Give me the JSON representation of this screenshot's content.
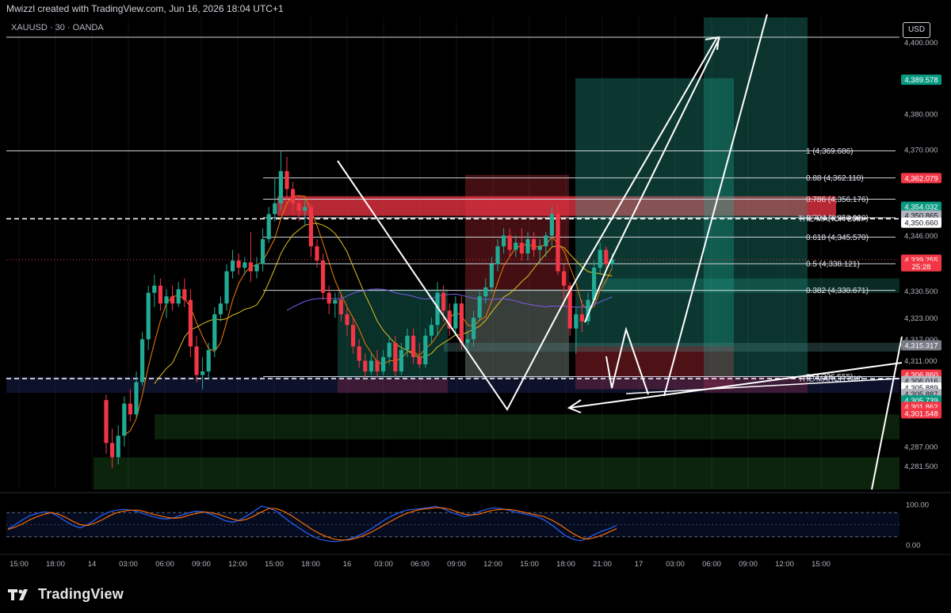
{
  "header": {
    "text": "Mwizzl created with TradingView.com, Jun 16, 2026 18:04 UTC+1",
    "symbol": "XAUUSD · 30 · OANDA",
    "currency": "USD"
  },
  "footer": {
    "brand": "TradingView"
  },
  "colors": {
    "up": "#22ab94",
    "down": "#f23645",
    "fast_ma": "#f57c00",
    "slow_ma": "#e0c020",
    "long_ma": "#7b5ce8",
    "stoch_k": "#2962ff",
    "stoch_d": "#ff6d00"
  },
  "chart_data": {
    "type": "candlestick",
    "symbol": "XAUUSD",
    "timeframe": "30",
    "ylim": [
      4275,
      4407
    ],
    "y_ticks": [
      4400,
      4390,
      4380,
      4370,
      4362,
      4350,
      4346,
      4338,
      4330.5,
      4323,
      4317,
      4311,
      4299,
      4287,
      4281.5
    ],
    "y_tick_labels": [
      "4,400.000",
      "",
      "4,380.000",
      "4,370.000",
      "",
      "",
      "4,346.000",
      "",
      "4,330.500",
      "4,323.000",
      "4,317.000",
      "4,311.000",
      "",
      "4,287.000",
      "4,281.500"
    ],
    "x_ticks": [
      "15:00",
      "18:00",
      "14",
      "03:00",
      "06:00",
      "09:00",
      "12:00",
      "15:00",
      "18:00",
      "16",
      "03:00",
      "06:00",
      "09:00",
      "12:00",
      "15:00",
      "18:00",
      "21:00",
      "17",
      "03:00",
      "06:00",
      "09:00",
      "12:00",
      "15:00"
    ],
    "candles": [
      {
        "i": 0,
        "o": 4300.0,
        "h": 4301.5,
        "l": 4285.0,
        "c": 4288.0
      },
      {
        "i": 1,
        "o": 4288.0,
        "h": 4292.0,
        "l": 4281.0,
        "c": 4284.0
      },
      {
        "i": 2,
        "o": 4284.0,
        "h": 4293.0,
        "l": 4282.0,
        "c": 4290.0
      },
      {
        "i": 3,
        "o": 4290.0,
        "h": 4301.0,
        "l": 4287.0,
        "c": 4299.0
      },
      {
        "i": 4,
        "o": 4299.0,
        "h": 4303.0,
        "l": 4294.0,
        "c": 4296.0
      },
      {
        "i": 5,
        "o": 4296.0,
        "h": 4308.0,
        "l": 4295.0,
        "c": 4305.0
      },
      {
        "i": 6,
        "o": 4305.0,
        "h": 4319.0,
        "l": 4304.0,
        "c": 4317.0
      },
      {
        "i": 7,
        "o": 4317.0,
        "h": 4332.0,
        "l": 4314.0,
        "c": 4330.0
      },
      {
        "i": 8,
        "o": 4330.0,
        "h": 4335.0,
        "l": 4326.0,
        "c": 4332.0
      },
      {
        "i": 9,
        "o": 4332.0,
        "h": 4334.0,
        "l": 4325.0,
        "c": 4327.0
      },
      {
        "i": 10,
        "o": 4327.0,
        "h": 4331.0,
        "l": 4323.0,
        "c": 4329.0
      },
      {
        "i": 11,
        "o": 4329.0,
        "h": 4332.0,
        "l": 4325.0,
        "c": 4327.0
      },
      {
        "i": 12,
        "o": 4327.0,
        "h": 4333.0,
        "l": 4326.0,
        "c": 4331.0
      },
      {
        "i": 13,
        "o": 4331.0,
        "h": 4334.0,
        "l": 4326.0,
        "c": 4328.0
      },
      {
        "i": 14,
        "o": 4328.0,
        "h": 4331.0,
        "l": 4312.0,
        "c": 4315.0
      },
      {
        "i": 15,
        "o": 4315.0,
        "h": 4318.0,
        "l": 4305.0,
        "c": 4307.0
      },
      {
        "i": 16,
        "o": 4307.0,
        "h": 4312.0,
        "l": 4303.0,
        "c": 4308.0
      },
      {
        "i": 17,
        "o": 4308.0,
        "h": 4316.0,
        "l": 4306.0,
        "c": 4314.0
      },
      {
        "i": 18,
        "o": 4314.0,
        "h": 4326.0,
        "l": 4312.0,
        "c": 4324.0
      },
      {
        "i": 19,
        "o": 4324.0,
        "h": 4329.0,
        "l": 4322.0,
        "c": 4327.0
      },
      {
        "i": 20,
        "o": 4327.0,
        "h": 4338.0,
        "l": 4325.0,
        "c": 4336.0
      },
      {
        "i": 21,
        "o": 4336.0,
        "h": 4342.0,
        "l": 4334.0,
        "c": 4339.0
      },
      {
        "i": 22,
        "o": 4339.0,
        "h": 4341.0,
        "l": 4335.0,
        "c": 4337.0
      },
      {
        "i": 23,
        "o": 4337.0,
        "h": 4340.0,
        "l": 4335.0,
        "c": 4338.5
      },
      {
        "i": 24,
        "o": 4338.5,
        "h": 4347.0,
        "l": 4333.0,
        "c": 4336.0
      },
      {
        "i": 25,
        "o": 4336.0,
        "h": 4340.0,
        "l": 4334.0,
        "c": 4338.0
      },
      {
        "i": 26,
        "o": 4338.0,
        "h": 4348.0,
        "l": 4336.0,
        "c": 4345.0
      },
      {
        "i": 27,
        "o": 4345.0,
        "h": 4354.0,
        "l": 4344.0,
        "c": 4352.0
      },
      {
        "i": 28,
        "o": 4352.0,
        "h": 4362.0,
        "l": 4350.0,
        "c": 4355.0
      },
      {
        "i": 29,
        "o": 4355.0,
        "h": 4369.5,
        "l": 4353.0,
        "c": 4364.0
      },
      {
        "i": 30,
        "o": 4364.0,
        "h": 4368.0,
        "l": 4356.0,
        "c": 4359.0
      },
      {
        "i": 31,
        "o": 4359.0,
        "h": 4361.0,
        "l": 4352.0,
        "c": 4355.0
      },
      {
        "i": 32,
        "o": 4355.0,
        "h": 4357.0,
        "l": 4350.0,
        "c": 4353.0
      },
      {
        "i": 33,
        "o": 4353.0,
        "h": 4356.0,
        "l": 4349.0,
        "c": 4354.0
      },
      {
        "i": 34,
        "o": 4354.0,
        "h": 4355.0,
        "l": 4340.0,
        "c": 4343.0
      },
      {
        "i": 35,
        "o": 4343.0,
        "h": 4345.0,
        "l": 4337.0,
        "c": 4339.0
      },
      {
        "i": 36,
        "o": 4339.0,
        "h": 4341.0,
        "l": 4328.0,
        "c": 4330.0
      },
      {
        "i": 37,
        "o": 4330.0,
        "h": 4332.0,
        "l": 4324.0,
        "c": 4327.0
      },
      {
        "i": 38,
        "o": 4327.0,
        "h": 4330.0,
        "l": 4323.0,
        "c": 4328.0
      },
      {
        "i": 39,
        "o": 4328.0,
        "h": 4330.0,
        "l": 4322.0,
        "c": 4324.0
      },
      {
        "i": 40,
        "o": 4324.0,
        "h": 4326.0,
        "l": 4318.0,
        "c": 4321.0
      },
      {
        "i": 41,
        "o": 4321.0,
        "h": 4323.0,
        "l": 4313.0,
        "c": 4315.0
      },
      {
        "i": 42,
        "o": 4315.0,
        "h": 4317.0,
        "l": 4309.0,
        "c": 4311.0
      },
      {
        "i": 43,
        "o": 4311.0,
        "h": 4313.0,
        "l": 4306.0,
        "c": 4308.0
      },
      {
        "i": 44,
        "o": 4308.0,
        "h": 4313.0,
        "l": 4307.0,
        "c": 4311.0
      },
      {
        "i": 45,
        "o": 4311.0,
        "h": 4314.0,
        "l": 4306.0,
        "c": 4308.0
      },
      {
        "i": 46,
        "o": 4308.0,
        "h": 4314.0,
        "l": 4307.0,
        "c": 4312.0
      },
      {
        "i": 47,
        "o": 4312.0,
        "h": 4318.0,
        "l": 4310.0,
        "c": 4316.0
      },
      {
        "i": 48,
        "o": 4316.0,
        "h": 4318.0,
        "l": 4306.5,
        "c": 4308.0
      },
      {
        "i": 49,
        "o": 4308.0,
        "h": 4316.0,
        "l": 4307.0,
        "c": 4314.0
      },
      {
        "i": 50,
        "o": 4314.0,
        "h": 4320.0,
        "l": 4312.0,
        "c": 4318.0
      },
      {
        "i": 51,
        "o": 4318.0,
        "h": 4320.0,
        "l": 4310.0,
        "c": 4312.0
      },
      {
        "i": 52,
        "o": 4312.0,
        "h": 4316.0,
        "l": 4309.0,
        "c": 4310.0
      },
      {
        "i": 53,
        "o": 4310.0,
        "h": 4320.0,
        "l": 4309.0,
        "c": 4318.0
      },
      {
        "i": 54,
        "o": 4318.0,
        "h": 4323.0,
        "l": 4316.0,
        "c": 4321.0
      },
      {
        "i": 55,
        "o": 4321.0,
        "h": 4333.0,
        "l": 4318.0,
        "c": 4330.0
      },
      {
        "i": 56,
        "o": 4330.0,
        "h": 4332.0,
        "l": 4322.0,
        "c": 4325.0
      },
      {
        "i": 57,
        "o": 4325.0,
        "h": 4327.0,
        "l": 4318.0,
        "c": 4320.0
      },
      {
        "i": 58,
        "o": 4320.0,
        "h": 4329.0,
        "l": 4318.0,
        "c": 4327.0
      },
      {
        "i": 59,
        "o": 4327.0,
        "h": 4329.0,
        "l": 4314.0,
        "c": 4316.0
      },
      {
        "i": 60,
        "o": 4316.0,
        "h": 4319.0,
        "l": 4313.0,
        "c": 4317.0
      },
      {
        "i": 61,
        "o": 4317.0,
        "h": 4325.0,
        "l": 4315.0,
        "c": 4323.0
      },
      {
        "i": 62,
        "o": 4323.0,
        "h": 4331.0,
        "l": 4322.0,
        "c": 4329.0
      },
      {
        "i": 63,
        "o": 4329.0,
        "h": 4334.0,
        "l": 4327.0,
        "c": 4331.5
      },
      {
        "i": 64,
        "o": 4331.5,
        "h": 4340.0,
        "l": 4330.0,
        "c": 4338.0
      },
      {
        "i": 65,
        "o": 4338.0,
        "h": 4345.0,
        "l": 4336.0,
        "c": 4343.0
      },
      {
        "i": 66,
        "o": 4343.0,
        "h": 4348.0,
        "l": 4341.0,
        "c": 4346.0
      },
      {
        "i": 67,
        "o": 4346.0,
        "h": 4348.0,
        "l": 4340.0,
        "c": 4342.0
      },
      {
        "i": 68,
        "o": 4342.0,
        "h": 4346.0,
        "l": 4340.0,
        "c": 4344.0
      },
      {
        "i": 69,
        "o": 4344.0,
        "h": 4348.0,
        "l": 4339.0,
        "c": 4341.0
      },
      {
        "i": 70,
        "o": 4341.0,
        "h": 4347.0,
        "l": 4339.0,
        "c": 4345.0
      },
      {
        "i": 71,
        "o": 4345.0,
        "h": 4347.0,
        "l": 4340.0,
        "c": 4342.0
      },
      {
        "i": 72,
        "o": 4342.0,
        "h": 4345.0,
        "l": 4338.0,
        "c": 4343.0
      },
      {
        "i": 73,
        "o": 4343.0,
        "h": 4347.0,
        "l": 4340.0,
        "c": 4346.0
      },
      {
        "i": 74,
        "o": 4346.0,
        "h": 4354.0,
        "l": 4343.0,
        "c": 4352.0
      },
      {
        "i": 75,
        "o": 4352.0,
        "h": 4354.5,
        "l": 4335.0,
        "c": 4336.0
      },
      {
        "i": 76,
        "o": 4336.0,
        "h": 4338.0,
        "l": 4326.0,
        "c": 4332.0
      },
      {
        "i": 77,
        "o": 4332.0,
        "h": 4333.0,
        "l": 4318.0,
        "c": 4320.0
      },
      {
        "i": 78,
        "o": 4320.0,
        "h": 4326.0,
        "l": 4313.0,
        "c": 4324.0
      },
      {
        "i": 79,
        "o": 4324.0,
        "h": 4328.0,
        "l": 4319.0,
        "c": 4322.0
      },
      {
        "i": 80,
        "o": 4322.0,
        "h": 4330.0,
        "l": 4321.0,
        "c": 4328.0
      },
      {
        "i": 81,
        "o": 4328.0,
        "h": 4339.0,
        "l": 4327.0,
        "c": 4337.0
      },
      {
        "i": 82,
        "o": 4337.0,
        "h": 4344.0,
        "l": 4335.0,
        "c": 4342.0
      },
      {
        "i": 83,
        "o": 4342.0,
        "h": 4343.0,
        "l": 4337.0,
        "c": 4338.0
      },
      {
        "i": 84,
        "o": 4338.0,
        "h": 4341.0,
        "l": 4337.0,
        "c": 4339.3
      }
    ],
    "fib_levels": [
      {
        "ratio": "1",
        "price": 4369.686,
        "label": "1 (4,369.686)"
      },
      {
        "ratio": "0.88",
        "price": 4362.11,
        "label": "0.88 (4,362.110)"
      },
      {
        "ratio": "0.786",
        "price": 4356.176,
        "label": "0.786 (4,356.176)"
      },
      {
        "ratio": "0.704",
        "price": 4351.0,
        "label": "0.704 (4,350.990)"
      },
      {
        "ratio": "0.618",
        "price": 4345.57,
        "label": "0.618 (4,345.570)"
      },
      {
        "ratio": "0.5",
        "price": 4338.121,
        "label": "0.5 (4,338.121)"
      },
      {
        "ratio": "0.382",
        "price": 4330.671,
        "label": "0.382 (4,330.671)"
      },
      {
        "ratio": "0",
        "price": 4306.555,
        "label": "0 (4,306.555)"
      }
    ],
    "annotations": [
      {
        "text": "THE MARCH 26th",
        "price": 4350.7
      },
      {
        "text": "THE MARCH 24th",
        "price": 4306.0
      }
    ],
    "price_tags": [
      {
        "label": "4,389.578",
        "price": 4389.578,
        "color": "#089981"
      },
      {
        "label": "4,362.079",
        "price": 4362.079,
        "color": "#f23645"
      },
      {
        "label": "4,354.032",
        "price": 4354.032,
        "color": "#089981"
      },
      {
        "label": "4,350.865",
        "price": 4351.6,
        "color": "#b2b5be"
      },
      {
        "label": "4,350.660",
        "price": 4349.6,
        "color": "#ffffff"
      },
      {
        "label": "4,339.255",
        "price": 4339.255,
        "color": "#f23645"
      },
      {
        "label": "25:28",
        "price": 4337.4,
        "color": "#f23645"
      },
      {
        "label": "4,315.317",
        "price": 4315.317,
        "color": "#787b86"
      },
      {
        "label": "4,306.860",
        "price": 4307.1,
        "color": "#f23645"
      },
      {
        "label": "4,306.016",
        "price": 4305.3,
        "color": "#b2b5be"
      },
      {
        "label": "4,305.889",
        "price": 4303.5,
        "color": "#ffffff"
      },
      {
        "label": "4,305.887",
        "price": 4301.7,
        "color": "#b2b5be"
      },
      {
        "label": "4,305.739",
        "price": 4299.9,
        "color": "#089981"
      },
      {
        "label": "4,301.862",
        "price": 4298.1,
        "color": "#f23645"
      },
      {
        "label": "4,301.548",
        "price": 4296.3,
        "color": "#f23645"
      }
    ],
    "stoch": {
      "ylim": [
        -20,
        120
      ],
      "ticks": [
        {
          "value": 100,
          "label": "100.00"
        },
        {
          "value": 0,
          "label": "0.00"
        }
      ],
      "bands": [
        80,
        20
      ],
      "k": [
        40,
        50,
        62,
        72,
        78,
        82,
        80,
        70,
        58,
        48,
        42,
        50,
        62,
        74,
        82,
        86,
        88,
        86,
        82,
        76,
        70,
        66,
        64,
        68,
        74,
        80,
        84,
        82,
        76,
        68,
        60,
        56,
        62,
        72,
        84,
        96,
        92,
        84,
        70,
        56,
        44,
        32,
        22,
        14,
        10,
        8,
        10,
        14,
        20,
        28,
        38,
        50,
        62,
        72,
        80,
        86,
        88,
        90,
        92,
        96,
        90,
        82,
        76,
        70,
        74,
        82,
        88,
        92,
        90,
        86,
        82,
        78,
        74,
        70,
        62,
        50,
        36,
        22,
        14,
        10,
        16,
        26,
        34,
        40,
        48
      ],
      "d": [
        38,
        44,
        52,
        62,
        70,
        76,
        80,
        76,
        68,
        58,
        50,
        48,
        54,
        62,
        72,
        80,
        84,
        86,
        86,
        82,
        76,
        72,
        68,
        66,
        68,
        74,
        78,
        82,
        80,
        76,
        70,
        64,
        60,
        64,
        72,
        82,
        90,
        90,
        84,
        74,
        62,
        50,
        38,
        28,
        20,
        14,
        12,
        12,
        16,
        22,
        30,
        40,
        50,
        60,
        70,
        78,
        84,
        88,
        90,
        92,
        92,
        88,
        82,
        76,
        74,
        76,
        82,
        86,
        88,
        88,
        86,
        82,
        78,
        74,
        70,
        62,
        52,
        40,
        28,
        18,
        14,
        18,
        24,
        32,
        40
      ]
    },
    "series": [
      {
        "name": "",
        "kind": "fast_ma"
      },
      {
        "name": "",
        "kind": "slow_ma"
      },
      {
        "name": "",
        "kind": "long_ma"
      }
    ],
    "title": "",
    "xlabel": "",
    "ylabel": ""
  }
}
